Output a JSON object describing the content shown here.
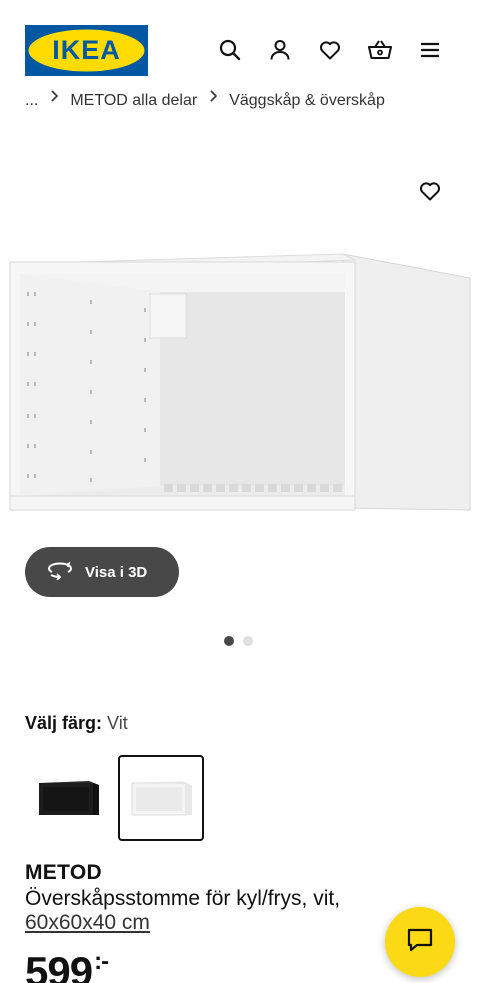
{
  "header": {
    "logo_text": "IKEA",
    "brand_blue": "#0058a3",
    "brand_yellow": "#ffdb00",
    "icons": [
      "search-icon",
      "user-icon",
      "heart-icon",
      "basket-icon",
      "menu-icon"
    ]
  },
  "breadcrumb": {
    "ellipsis": "...",
    "items": [
      "METOD alla delar",
      "Väggskåp & överskåp"
    ]
  },
  "gallery": {
    "view_3d_label": "Visa i 3D",
    "current_image": 1,
    "image_count": 2
  },
  "color_selector": {
    "label": "Välj färg:",
    "selected_value": "Vit",
    "options": [
      "black",
      "white"
    ]
  },
  "product": {
    "name": "METOD",
    "description": "Överskåpsstomme för kyl/frys, vit,",
    "dimensions": "60x60x40 cm",
    "price": "599",
    "currency_suffix": ":-"
  },
  "chat": {
    "icon": "chat-icon",
    "accent": "#fbd914"
  }
}
